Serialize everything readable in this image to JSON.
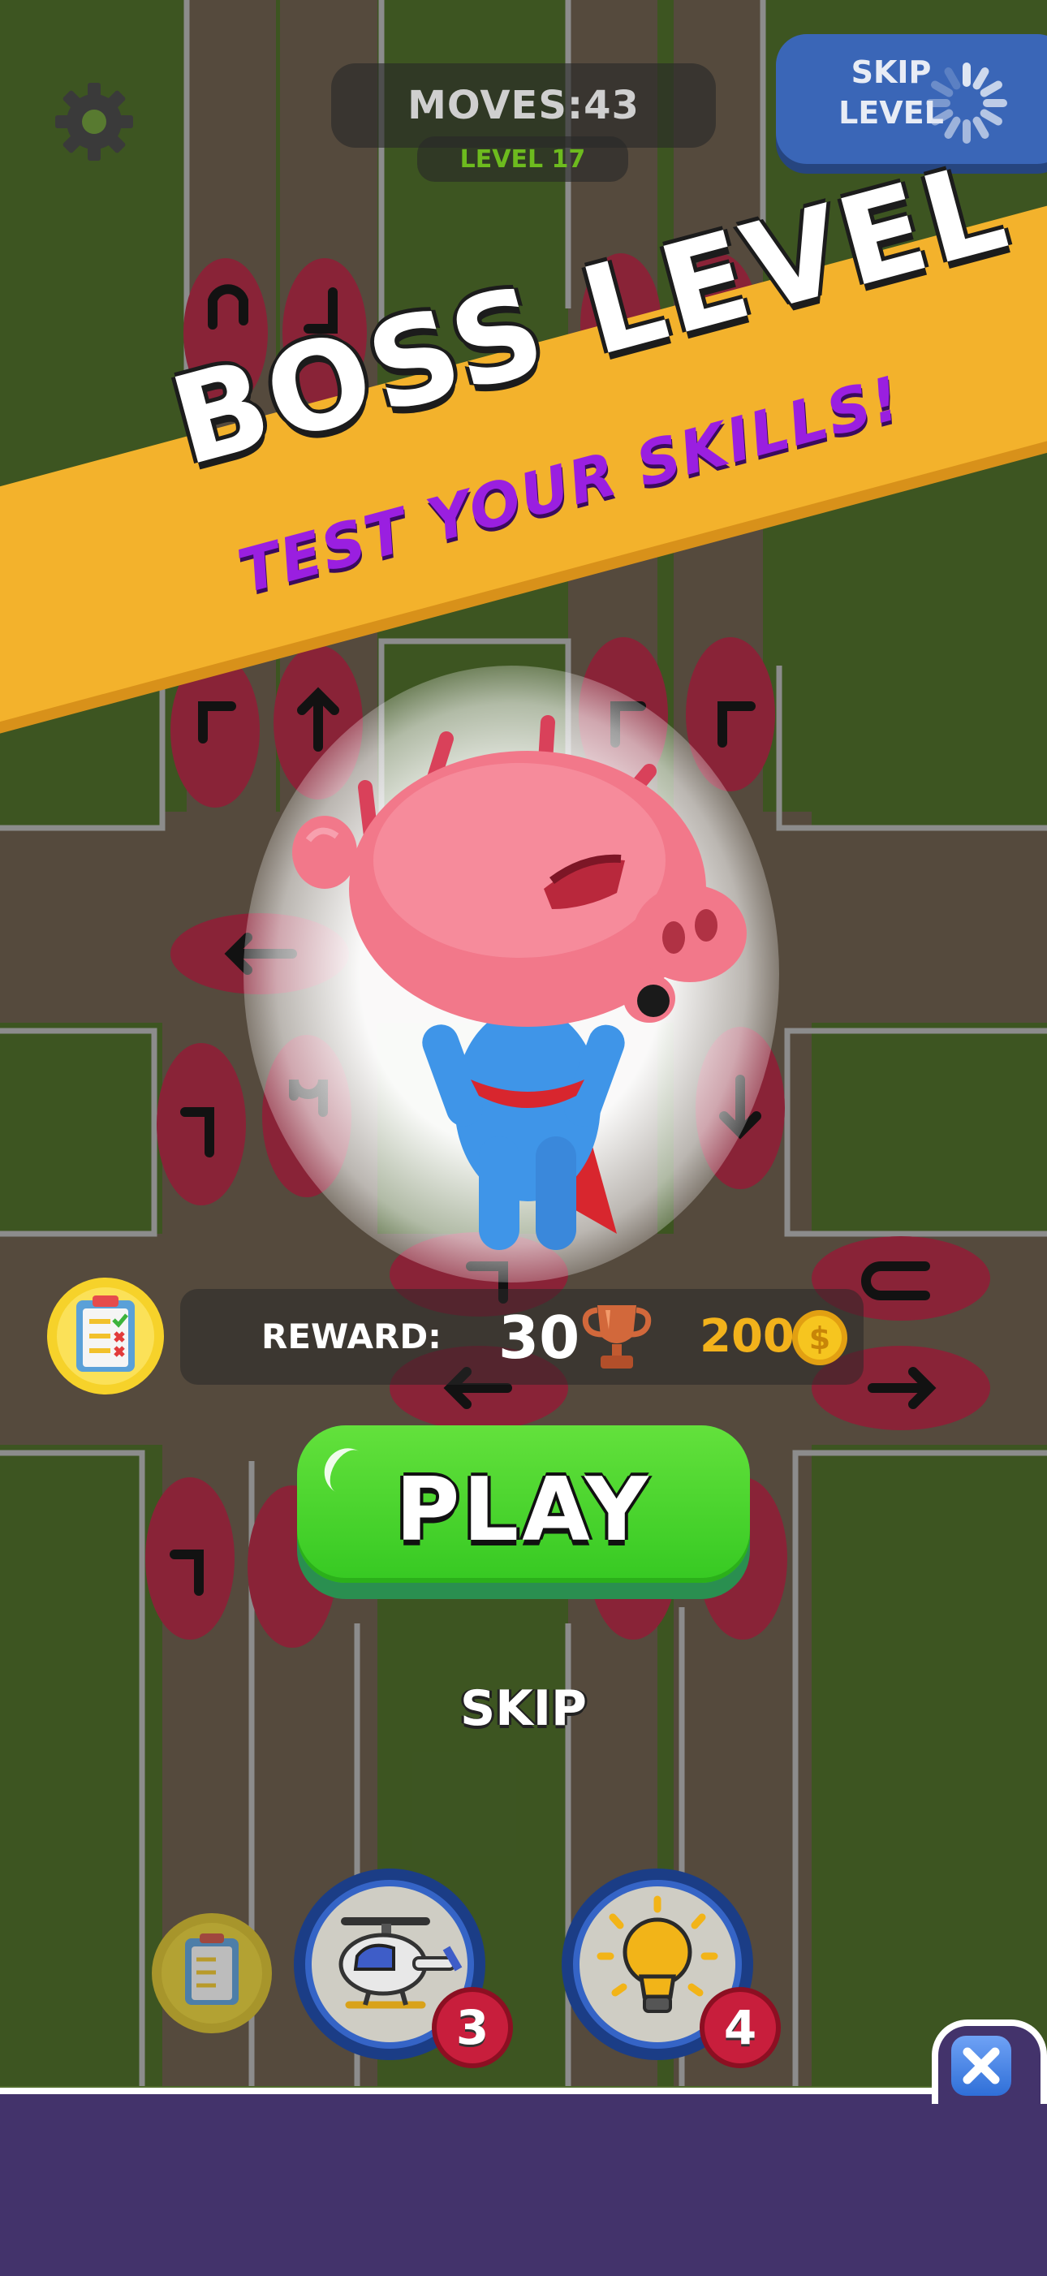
{
  "hud": {
    "moves_text": "MOVES:43",
    "level_text": "LEVEL 17",
    "skip_level_line1": "SKIP",
    "skip_level_line2": "LEVEL",
    "settings_icon": "gear-icon",
    "loading_icon": "spinner-icon"
  },
  "banner": {
    "title": "BOSS LEVEL",
    "subtitle": "TEST YOUR SKILLS!",
    "color": "#f3b22c",
    "subtitle_color": "#9a1fe0"
  },
  "boss": {
    "character": "boss-pig-hero"
  },
  "reward": {
    "label": "REWARD:",
    "trophies": "30",
    "coins": "200",
    "trophy_icon": "trophy-icon",
    "coin_icon": "coin-icon",
    "clipboard_icon": "clipboard-icon"
  },
  "buttons": {
    "play": "PLAY",
    "skip": "SKIP",
    "play_color": "#3fd22a"
  },
  "boosters": [
    {
      "name": "clipboard",
      "icon": "clipboard-icon",
      "count": ""
    },
    {
      "name": "helicopter",
      "icon": "helicopter-icon",
      "count": "3"
    },
    {
      "name": "hint",
      "icon": "lightbulb-icon",
      "count": "4"
    }
  ],
  "close": {
    "icon": "close-icon"
  }
}
